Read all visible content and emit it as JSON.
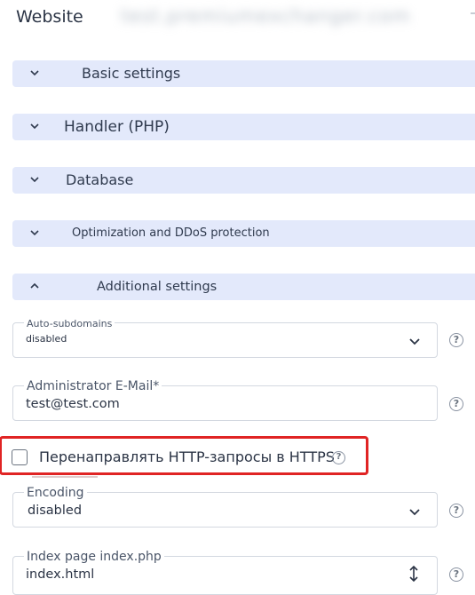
{
  "header": {
    "title": "Website",
    "domain": "test.premiumexchanger.com"
  },
  "sections": [
    {
      "label": "Basic settings",
      "expanded": false
    },
    {
      "label": "Handler (PHP)",
      "expanded": false
    },
    {
      "label": "Database",
      "expanded": false
    },
    {
      "label": "Optimization and DDoS protection",
      "expanded": false
    },
    {
      "label": "Additional settings",
      "expanded": true
    }
  ],
  "fields": {
    "auto_subdomains": {
      "label": "Auto-subdomains",
      "value": "disabled"
    },
    "admin_email": {
      "label": "Administrator E-Mail*",
      "value": "test@test.com"
    },
    "redirect_https": {
      "label": "Перенаправлять HTTP-запросы в HTTPS",
      "checked": false
    },
    "encoding": {
      "label": "Encoding",
      "value": "disabled"
    },
    "index_page": {
      "label": "Index page index.php",
      "value": "index.html"
    }
  },
  "help_symbol": "?",
  "colors": {
    "accordion_bg": "#e3e9fb",
    "highlight": "#e02424",
    "border": "#d3d8e0"
  }
}
